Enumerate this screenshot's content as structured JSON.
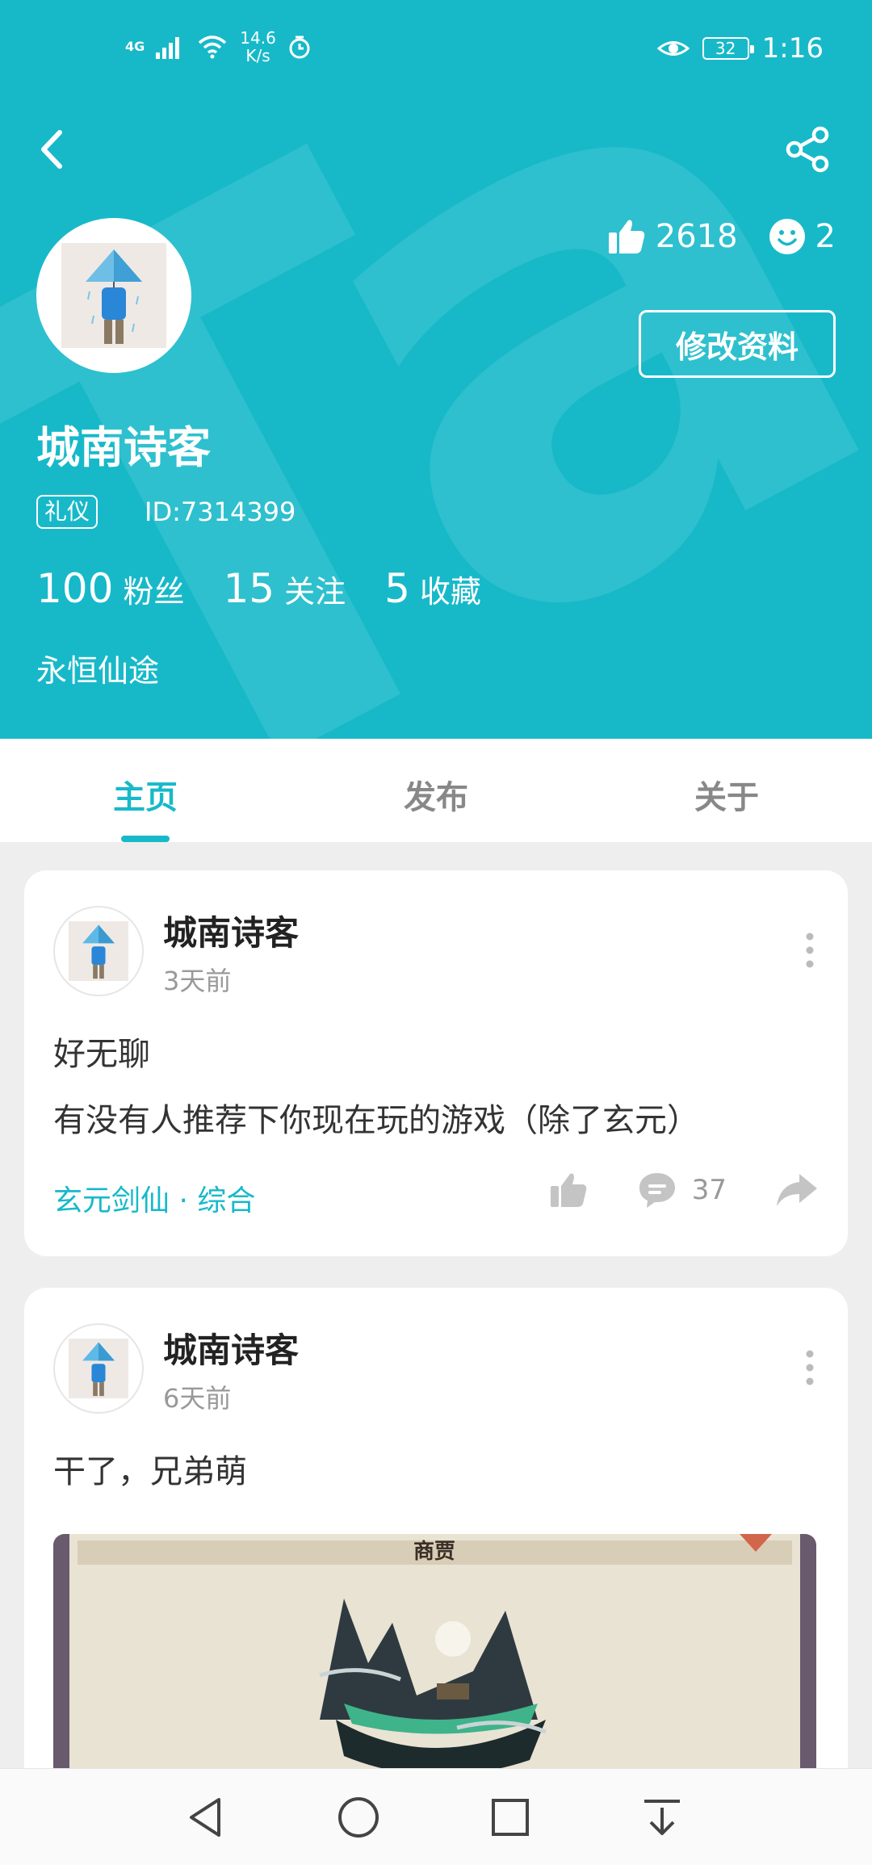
{
  "status_bar": {
    "network": "4G",
    "speed_value": "14.6",
    "speed_unit": "K/s",
    "battery": "32",
    "time": "1:16"
  },
  "profile": {
    "username": "城南诗客",
    "tag": "礼仪",
    "id_text": "ID:7314399",
    "likes": "2618",
    "smiles": "2",
    "edit_label": "修改资料",
    "fans_count": "100",
    "fans_label": "粉丝",
    "following_count": "15",
    "following_label": "关注",
    "favorites_count": "5",
    "favorites_label": "收藏",
    "bio": "永恒仙途"
  },
  "tabs": [
    {
      "label": "主页",
      "active": true
    },
    {
      "label": "发布",
      "active": false
    },
    {
      "label": "关于",
      "active": false
    }
  ],
  "posts": [
    {
      "author": "城南诗客",
      "time": "3天前",
      "lines": [
        "好无聊",
        "有没有人推荐下你现在玩的游戏（除了玄元）"
      ],
      "category": "玄元剑仙 · 综合",
      "comments": "37"
    },
    {
      "author": "城南诗客",
      "time": "6天前",
      "lines": [
        "干了，兄弟萌"
      ],
      "image_caption": "商贾"
    }
  ],
  "colors": {
    "accent": "#17b9c9",
    "background": "#eeeeee"
  },
  "icons": [
    "back-icon",
    "share-icon",
    "thumb-up-icon",
    "smile-icon",
    "more-icon",
    "comment-icon",
    "forward-icon",
    "nav-back-icon",
    "nav-home-icon",
    "nav-recent-icon",
    "nav-notification-icon"
  ]
}
